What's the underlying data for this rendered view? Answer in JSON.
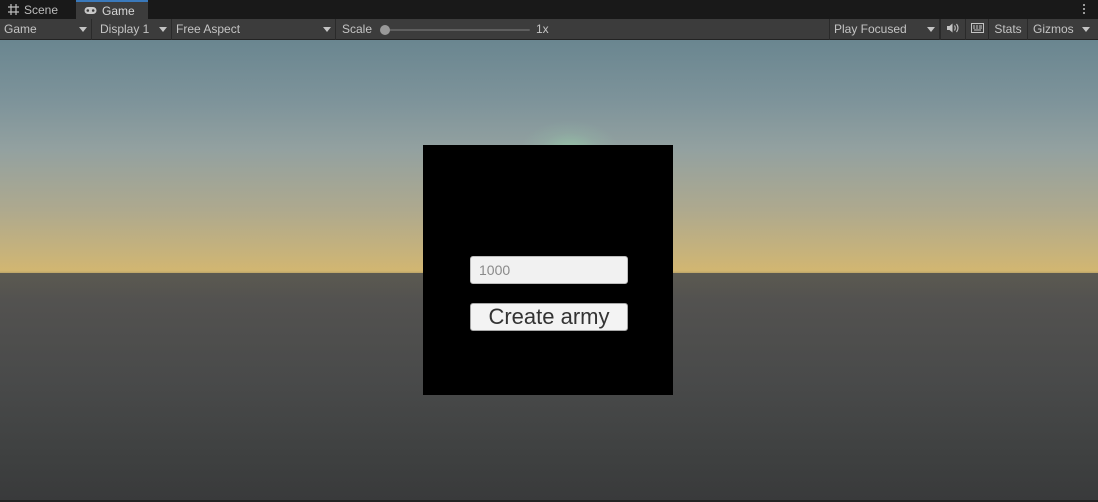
{
  "tabs": [
    {
      "label": "Scene",
      "icon": "grid-icon",
      "active": false
    },
    {
      "label": "Game",
      "icon": "gamepad-icon",
      "active": true
    }
  ],
  "toolbar": {
    "view_mode": "Game",
    "display": "Display 1",
    "aspect": "Free Aspect",
    "scale_label": "Scale",
    "scale_value": "1x",
    "scale_fraction": 0,
    "play_mode": "Play Focused",
    "audio_icon": "speaker-icon",
    "keyboard_icon": "keyboard-icon",
    "stats_label": "Stats",
    "gizmos_label": "Gizmos"
  },
  "game": {
    "input_placeholder": "1000",
    "button_label": "Create army"
  },
  "colors": {
    "tab_bar": "#191919",
    "toolbar": "#3c3c3c",
    "active_tab_accent": "#3a79bb",
    "panel": "#000000",
    "input_bg": "#f1f1f1",
    "button_bg": "#f3f3f3"
  }
}
